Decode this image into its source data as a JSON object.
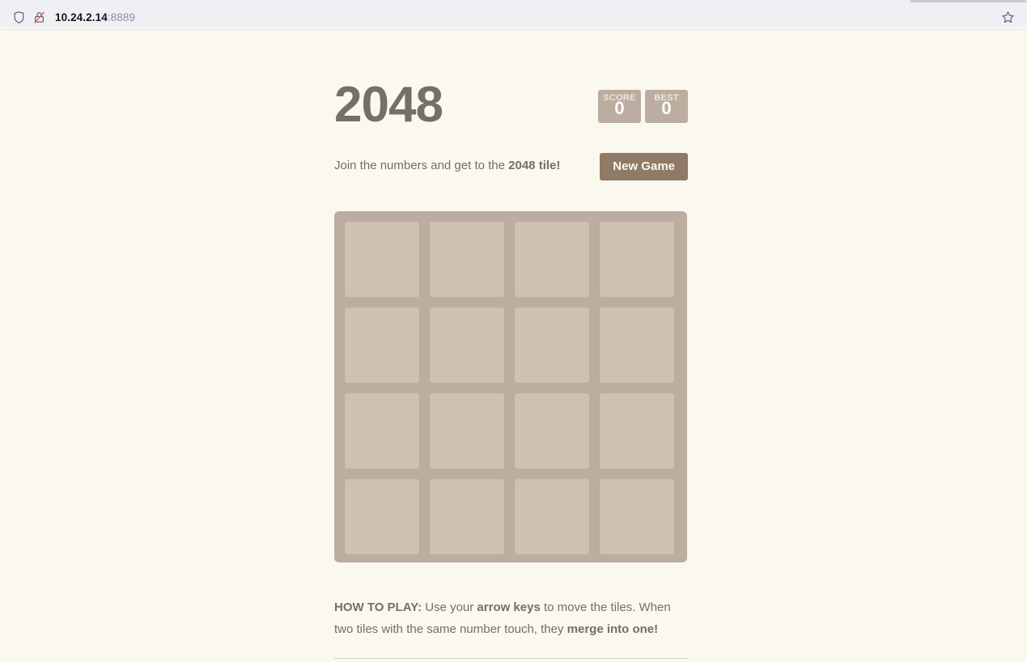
{
  "browser": {
    "url_host": "10.24.2.14",
    "url_port": ":8889",
    "shield_icon": "shield-icon",
    "lock_icon": "insecure-lock-icon",
    "bookmark_icon": "bookmark-star-icon"
  },
  "game": {
    "title": "2048",
    "intro_prefix": "Join the numbers and get to the ",
    "intro_strong": "2048 tile!",
    "restart_label": "New Game",
    "scores": [
      {
        "label": "SCORE",
        "value": "0",
        "name": "score-box"
      },
      {
        "label": "BEST",
        "value": "0",
        "name": "best-box"
      }
    ],
    "explanation_strong_1": "HOW TO PLAY:",
    "explanation_text_1": " Use your ",
    "explanation_strong_2": "arrow keys",
    "explanation_text_2": " to move the tiles. When two tiles with the same number touch, they ",
    "explanation_strong_3": "merge into one!",
    "grid": {
      "rows": 4,
      "cols": 4,
      "tiles": []
    }
  },
  "colors": {
    "page_background": "#faf8ef",
    "text": "#776e65",
    "grid_background": "#bbada0",
    "cell_background": "#cdc1b4",
    "button": "#8f7a66",
    "score_label": "#eee4da"
  }
}
